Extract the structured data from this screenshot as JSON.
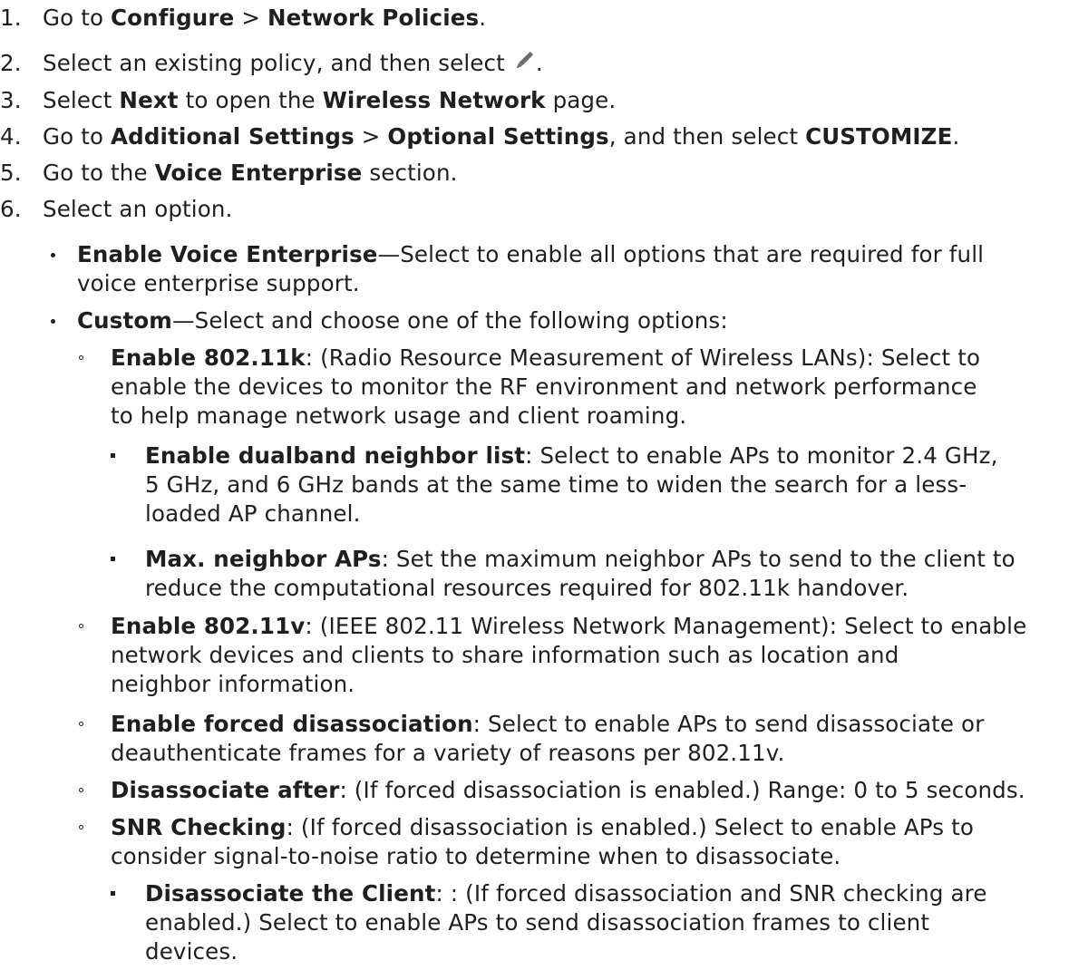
{
  "steps": [
    {
      "num": "1.",
      "t1": "Go to ",
      "b1": "Configure",
      "t2": " > ",
      "b2": "Network Policies",
      "t3": "."
    },
    {
      "num": "2.",
      "t1": "Select an existing policy, and then select ",
      "t2": "."
    },
    {
      "num": "3.",
      "t1": "Select ",
      "b1": "Next",
      "t2": " to open the ",
      "b2": "Wireless Network",
      "t3": " page."
    },
    {
      "num": "4.",
      "t1": "Go to ",
      "b1": "Additional Settings",
      "t2": " > ",
      "b2": "Optional Settings",
      "t3": ", and then select ",
      "b3": "CUSTOMIZE",
      "t4": "."
    },
    {
      "num": "5.",
      "t1": "Go to the ",
      "b1": "Voice Enterprise",
      "t2": " section."
    },
    {
      "num": "6.",
      "t1": "Select an option."
    }
  ],
  "options": {
    "enable_voice": {
      "label": "Enable Voice Enterprise",
      "line1": "—Select to enable all options that are required for full",
      "line2": "voice enterprise support."
    },
    "custom": {
      "label": "Custom",
      "line1": "—Select and choose one of the following options:"
    }
  },
  "custom_options": {
    "k": {
      "label": "Enable 802.11k",
      "line1": ": (Radio Resource Measurement of Wireless LANs): Select to",
      "line2": "enable the devices to monitor the RF environment and network performance",
      "line3": "to help manage network usage and client roaming."
    },
    "dualband": {
      "label": "Enable dualband neighbor list",
      "line1": ": Select to enable APs to monitor 2.4 GHz,",
      "line2": "5 GHz, and 6 GHz bands at the same time to widen the search for a less-",
      "line3": "loaded AP channel."
    },
    "maxneighbor": {
      "label": "Max. neighbor APs",
      "line1": ": Set the maximum neighbor APs to send to the client to",
      "line2": "reduce the computational resources required for 802.11k handover."
    },
    "v": {
      "label": "Enable 802.11v",
      "line1": ": (IEEE 802.11 Wireless Network Management): Select to enable",
      "line2": "network devices and clients to share information such as location and",
      "line3": "neighbor information."
    },
    "forced": {
      "label": "Enable forced disassociation",
      "line1": ": Select to enable APs to send disassociate or",
      "line2": "deauthenticate frames for a variety of reasons per 802.11v."
    },
    "after": {
      "label": "Disassociate after",
      "line1": ": (If forced disassociation is enabled.) Range: 0 to 5 seconds."
    },
    "snr": {
      "label": "SNR Checking",
      "line1": ": (If forced disassociation is enabled.) Select to enable APs to",
      "line2": "consider signal-to-noise ratio to determine when to disassociate."
    },
    "client": {
      "label": "Disassociate the Client",
      "line1": ": : (If forced disassociation and SNR checking are",
      "line2": "enabled.) Select to enable APs to send disassociation frames to client",
      "line3": "devices."
    }
  },
  "icons": {
    "edit": "pencil-icon",
    "color": "#1f1f1f"
  }
}
